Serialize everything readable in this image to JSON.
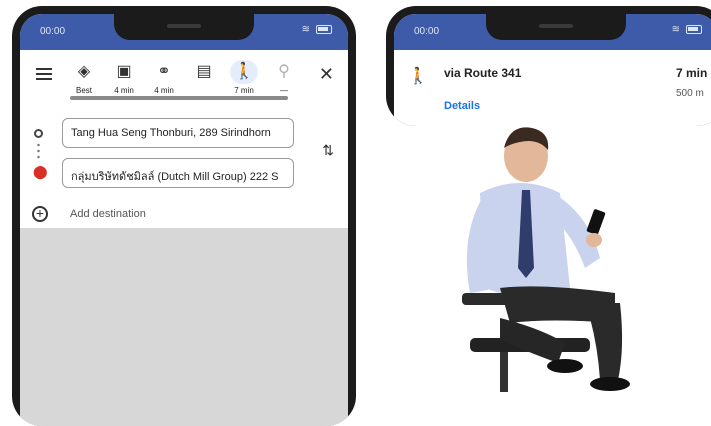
{
  "status": {
    "time": "00:00"
  },
  "left": {
    "modes": [
      {
        "icon": "best-route-icon",
        "label": "Best"
      },
      {
        "icon": "car-icon",
        "label": "4 min"
      },
      {
        "icon": "motorcycle-icon",
        "label": "4 min"
      },
      {
        "icon": "transit-icon",
        "label": ""
      },
      {
        "icon": "walk-icon",
        "label": "7 min",
        "active": true
      },
      {
        "icon": "bike-icon",
        "label": "—"
      }
    ],
    "origin": "Tang Hua Seng Thonburi, 289 Sirindhorn",
    "destination": "กลุ่มบริษัทดัชมิลล์ (Dutch Mill Group) 222 S",
    "add_destination": "Add destination"
  },
  "right": {
    "via": "via Route 341",
    "duration": "7 min",
    "distance": "500 m",
    "details": "Details"
  },
  "colors": {
    "status_bar": "#3d5ba9",
    "accent": "#1a73e8",
    "pin": "#d93025",
    "map": "#d7d7d7"
  }
}
